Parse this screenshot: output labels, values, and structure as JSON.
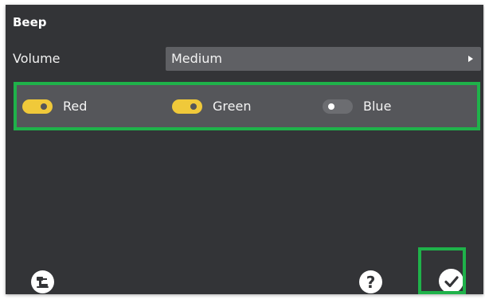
{
  "dialog": {
    "title": "Beep"
  },
  "volume": {
    "label": "Volume",
    "selected": "Medium"
  },
  "colors": [
    {
      "label": "Red",
      "enabled": true
    },
    {
      "label": "Green",
      "enabled": true
    },
    {
      "label": "Blue",
      "enabled": false
    }
  ],
  "icons": {
    "bottom_left": "robot-arm-icon",
    "help": "question-icon",
    "confirm": "checkmark-icon"
  },
  "accent": {
    "highlight": "#1fb24a",
    "toggle_on": "#f0c93a"
  }
}
